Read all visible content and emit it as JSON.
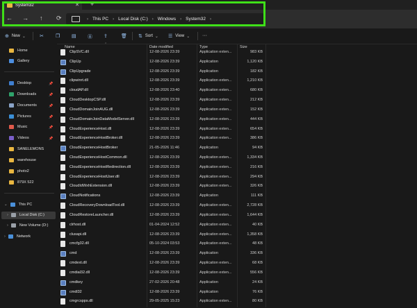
{
  "tab": {
    "title": "System32",
    "close": "✕",
    "new": "+"
  },
  "nav": {
    "back": "←",
    "forward": "→",
    "up": "↑",
    "refresh": "⟳",
    "more": "›"
  },
  "breadcrumb": [
    "This PC",
    "Local Disk (C:)",
    "Windows",
    "System32"
  ],
  "toolbar": {
    "new": "New",
    "sort": "Sort",
    "view": "View",
    "more": "···"
  },
  "sidebar": {
    "top": [
      {
        "label": "Home",
        "icon": "home-icon"
      },
      {
        "label": "Gallery",
        "icon": "gallery-icon"
      }
    ],
    "quick": [
      {
        "label": "Desktop",
        "icon": "desktop-icon"
      },
      {
        "label": "Downloads",
        "icon": "downloads-icon"
      },
      {
        "label": "Documents",
        "icon": "documents-icon"
      },
      {
        "label": "Pictures",
        "icon": "pictures-icon"
      },
      {
        "label": "Music",
        "icon": "music-icon"
      },
      {
        "label": "Videos",
        "icon": "videos-icon"
      },
      {
        "label": "SANELEMONS",
        "icon": "folder-icon"
      },
      {
        "label": "warehouse",
        "icon": "folder-icon"
      },
      {
        "label": "photo2",
        "icon": "folder-icon"
      },
      {
        "label": "879X 522",
        "icon": "folder-icon"
      }
    ],
    "tree": [
      {
        "label": "This PC",
        "icon": "pc-icon"
      },
      {
        "label": "Local Disk (C:)",
        "icon": "drive-icon"
      },
      {
        "label": "New Volume (D:)",
        "icon": "drive-icon"
      },
      {
        "label": "Network",
        "icon": "network-icon"
      }
    ]
  },
  "columns": {
    "name": "Name",
    "date": "Date modified",
    "type": "Type",
    "size": "Size"
  },
  "files": [
    {
      "name": "ClipSVC.dll",
      "date": "12-08-2026 23:39",
      "type": "Application exten...",
      "size": "983 KB",
      "kind": "dll"
    },
    {
      "name": "ClipUp",
      "date": "12-08-2026 23:39",
      "type": "Application",
      "size": "1,120 KB",
      "kind": "app"
    },
    {
      "name": "ClipUpgrade",
      "date": "12-08-2026 23:39",
      "type": "Application",
      "size": "182 KB",
      "kind": "app"
    },
    {
      "name": "clipwinrt.dll",
      "date": "12-08-2026 23:39",
      "type": "Application exten...",
      "size": "1,210 KB",
      "kind": "dll"
    },
    {
      "name": "cloudAP.dll",
      "date": "12-08-2026 23:40",
      "type": "Application exten...",
      "size": "680 KB",
      "kind": "dll"
    },
    {
      "name": "CloudDesktopCSP.dll",
      "date": "12-08-2026 23:39",
      "type": "Application exten...",
      "size": "212 KB",
      "kind": "dll"
    },
    {
      "name": "CloudDomainJoinAUG.dll",
      "date": "12-08-2026 23:39",
      "type": "Application exten...",
      "size": "152 KB",
      "kind": "dll"
    },
    {
      "name": "CloudDomainJoinDataModelServer.dll",
      "date": "12-08-2026 23:39",
      "type": "Application exten...",
      "size": "444 KB",
      "kind": "dll"
    },
    {
      "name": "CloudExperienceHost.dll",
      "date": "12-08-2026 23:39",
      "type": "Application exten...",
      "size": "654 KB",
      "kind": "dll"
    },
    {
      "name": "CloudExperienceHostBroker.dll",
      "date": "12-08-2026 23:39",
      "type": "Application exten...",
      "size": "386 KB",
      "kind": "dll"
    },
    {
      "name": "CloudExperienceHostBroker",
      "date": "21-05-2026 11:46",
      "type": "Application",
      "size": "94 KB",
      "kind": "app"
    },
    {
      "name": "CloudExperienceHostCommon.dll",
      "date": "12-08-2026 23:39",
      "type": "Application exten...",
      "size": "1,334 KB",
      "kind": "dll"
    },
    {
      "name": "CloudExperienceHostRedirection.dll",
      "date": "12-08-2026 23:39",
      "type": "Application exten...",
      "size": "216 KB",
      "kind": "dll"
    },
    {
      "name": "CloudExperienceHostUser.dll",
      "date": "12-08-2026 23:39",
      "type": "Application exten...",
      "size": "294 KB",
      "kind": "dll"
    },
    {
      "name": "CloudIdWxhExtension.dll",
      "date": "12-08-2026 23:39",
      "type": "Application exten...",
      "size": "326 KB",
      "kind": "dll"
    },
    {
      "name": "CloudNotifications",
      "date": "12-08-2026 23:39",
      "type": "Application",
      "size": "111 KB",
      "kind": "app"
    },
    {
      "name": "CloudRecoveryDownloadTool.dll",
      "date": "12-08-2026 23:39",
      "type": "Application exten...",
      "size": "2,728 KB",
      "kind": "dll"
    },
    {
      "name": "CloudRestoreLauncher.dll",
      "date": "12-08-2026 23:39",
      "type": "Application exten...",
      "size": "1,644 KB",
      "kind": "dll"
    },
    {
      "name": "clrhost.dll",
      "date": "01-04-2024 12:52",
      "type": "Application exten...",
      "size": "40 KB",
      "kind": "dll"
    },
    {
      "name": "clusapi.dll",
      "date": "12-08-2026 23:39",
      "type": "Application exten...",
      "size": "1,358 KB",
      "kind": "dll"
    },
    {
      "name": "cmcfg32.dll",
      "date": "05-10-2024 03:53",
      "type": "Application exten...",
      "size": "48 KB",
      "kind": "dll"
    },
    {
      "name": "cmd",
      "date": "12-08-2026 23:39",
      "type": "Application",
      "size": "336 KB",
      "kind": "app"
    },
    {
      "name": "cmdext.dll",
      "date": "12-08-2026 23:39",
      "type": "Application exten...",
      "size": "68 KB",
      "kind": "dll"
    },
    {
      "name": "cmdial32.dll",
      "date": "12-08-2026 23:39",
      "type": "Application exten...",
      "size": "556 KB",
      "kind": "dll"
    },
    {
      "name": "cmdkey",
      "date": "27-02-2026 20:48",
      "type": "Application",
      "size": "24 KB",
      "kind": "app"
    },
    {
      "name": "cmdl32",
      "date": "12-08-2026 23:39",
      "type": "Application",
      "size": "76 KB",
      "kind": "app"
    },
    {
      "name": "cmgrcspps.dll",
      "date": "29-05-2025 15:23",
      "type": "Application exten...",
      "size": "80 KB",
      "kind": "dll"
    }
  ],
  "colors": {
    "accent_highlight": "#3fe018",
    "folder": "#e9b640",
    "background": "#191919"
  }
}
